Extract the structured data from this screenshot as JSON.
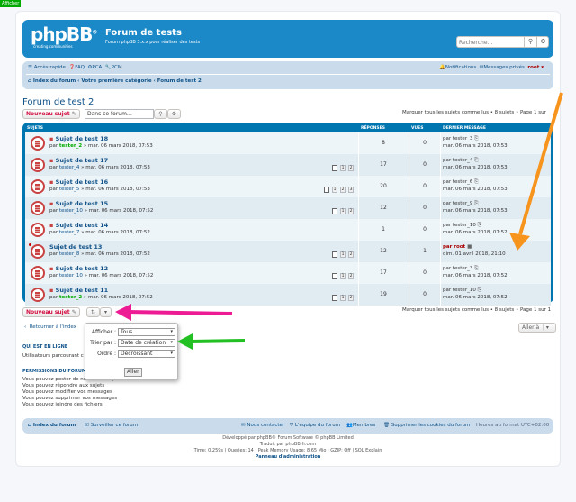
{
  "top_label": "Afficher",
  "header": {
    "logo": "phpBB",
    "logo_reg": "®",
    "logo_sub": "creating  communities",
    "title": "Forum de tests",
    "desc": "Forum phpBB 3.x.x pour réaliser des tests",
    "search_placeholder": "Recherche…"
  },
  "navbar": {
    "quick": "Accès rapide",
    "faq": "FAQ",
    "acp": "PCA",
    "mcp": "PCM",
    "notifications": "Notifications",
    "pm": "Messages privés",
    "user": "root",
    "bc_index": "Index du forum",
    "bc_cat": "Votre première catégorie",
    "bc_forum": "Forum de test 2",
    "bc_sep": "‹"
  },
  "forum": {
    "title": "Forum de test 2",
    "new_topic": "Nouveau sujet",
    "search_placeholder": "Dans ce forum…",
    "mark_read": "Marquer tous les sujets comme lus • 8 sujets • Page 1 sur 1",
    "mark_read_top": "Marquer tous les sujets comme lus • 8 sujets • Page 1 sur"
  },
  "table": {
    "headers": {
      "topics": "SUJETS",
      "replies": "RÉPONSES",
      "views": "VUES",
      "last": "DERNIER MESSAGE"
    },
    "rows": [
      {
        "title": "Sujet de test 18",
        "by": "par",
        "author": "tester_2",
        "date": "» mar. 06 mars 2018, 07:53",
        "replies": "8",
        "views": "0",
        "last_by": "par tester_3",
        "last_date": "mar. 06 mars 2018, 07:53",
        "pages": []
      },
      {
        "title": "Sujet de test 17",
        "by": "par",
        "author": "tester_4",
        "date": "» mar. 06 mars 2018, 07:53",
        "replies": "17",
        "views": "0",
        "last_by": "par tester_4",
        "last_date": "mar. 06 mars 2018, 07:53",
        "pages": [
          "1",
          "2"
        ]
      },
      {
        "title": "Sujet de test 16",
        "by": "par",
        "author": "tester_5",
        "date": "» mar. 06 mars 2018, 07:53",
        "replies": "20",
        "views": "0",
        "last_by": "par tester_6",
        "last_date": "mar. 06 mars 2018, 07:53",
        "pages": [
          "1",
          "2",
          "3"
        ]
      },
      {
        "title": "Sujet de test 15",
        "by": "par",
        "author": "tester_10",
        "date": "» mar. 06 mars 2018, 07:52",
        "replies": "12",
        "views": "0",
        "last_by": "par tester_9",
        "last_date": "mar. 06 mars 2018, 07:53",
        "pages": [
          "1",
          "2"
        ]
      },
      {
        "title": "Sujet de test 14",
        "by": "par",
        "author": "tester_7",
        "date": "» mar. 06 mars 2018, 07:52",
        "replies": "1",
        "views": "0",
        "last_by": "par tester_10",
        "last_date": "mar. 06 mars 2018, 07:52",
        "pages": []
      },
      {
        "title": "Sujet de test 13",
        "by": "par",
        "author": "tester_8",
        "date": "» mar. 06 mars 2018, 07:52",
        "replies": "12",
        "views": "1",
        "last_by": "par root",
        "last_date": "dim. 01 avril 2018, 21:10",
        "pages": [
          "1",
          "2"
        ]
      },
      {
        "title": "Sujet de test 12",
        "by": "par",
        "author": "tester_10",
        "date": "» mar. 06 mars 2018, 07:52",
        "replies": "17",
        "views": "0",
        "last_by": "par tester_3",
        "last_date": "mar. 06 mars 2018, 07:52",
        "pages": [
          "1",
          "2"
        ]
      },
      {
        "title": "Sujet de test 11",
        "by": "par",
        "author": "tester_2",
        "date": "» mar. 06 mars 2018, 07:52",
        "replies": "19",
        "views": "0",
        "last_by": "par tester_10",
        "last_date": "mar. 06 mars 2018, 07:52",
        "pages": [
          "1",
          "2"
        ]
      }
    ]
  },
  "dropdown": {
    "show_label": "Afficher :",
    "show_value": "Tous",
    "sort_label": "Trier par :",
    "sort_value": "Date de création",
    "order_label": "Ordre :",
    "order_value": "Décroissant",
    "go": "Aller"
  },
  "bottom": {
    "return": "Retourner à l'index",
    "jump": "Aller à",
    "online_h": "QUI EST EN LIGNE",
    "online_txt": "Utilisateurs parcourant c",
    "perm_h": "PERMISSIONS DU FORUM",
    "perms": [
      "Vous pouvez poster de nouveaux sujets",
      "Vous pouvez répondre aux sujets",
      "Vous pouvez modifier vos messages",
      "Vous pouvez supprimer vos messages",
      "Vous pouvez joindre des fichiers"
    ]
  },
  "footer": {
    "index": "Index du forum",
    "watch": "Surveiller ce forum",
    "contact": "Nous contacter",
    "team": "L'équipe du forum",
    "members": "Membres",
    "cookies": "Supprimer les cookies du forum",
    "tz": "Heures au format UTC+02:00",
    "line1": "Développé par phpBB® Forum Software © phpBB Limited",
    "line2": "Traduit par phpBB-fr.com",
    "line3": "Time: 0.259s | Queries: 14 | Peak Memory Usage: 8.65 Mio | GZIP: Off | SQL Explain",
    "line4": "Panneau d'administration"
  },
  "colors": {
    "accent": "#0076b1",
    "brand_header": "#1b89c8",
    "orange_arrow": "#f7941d",
    "magenta_arrow": "#ee1c94",
    "green_arrow": "#22c022"
  }
}
